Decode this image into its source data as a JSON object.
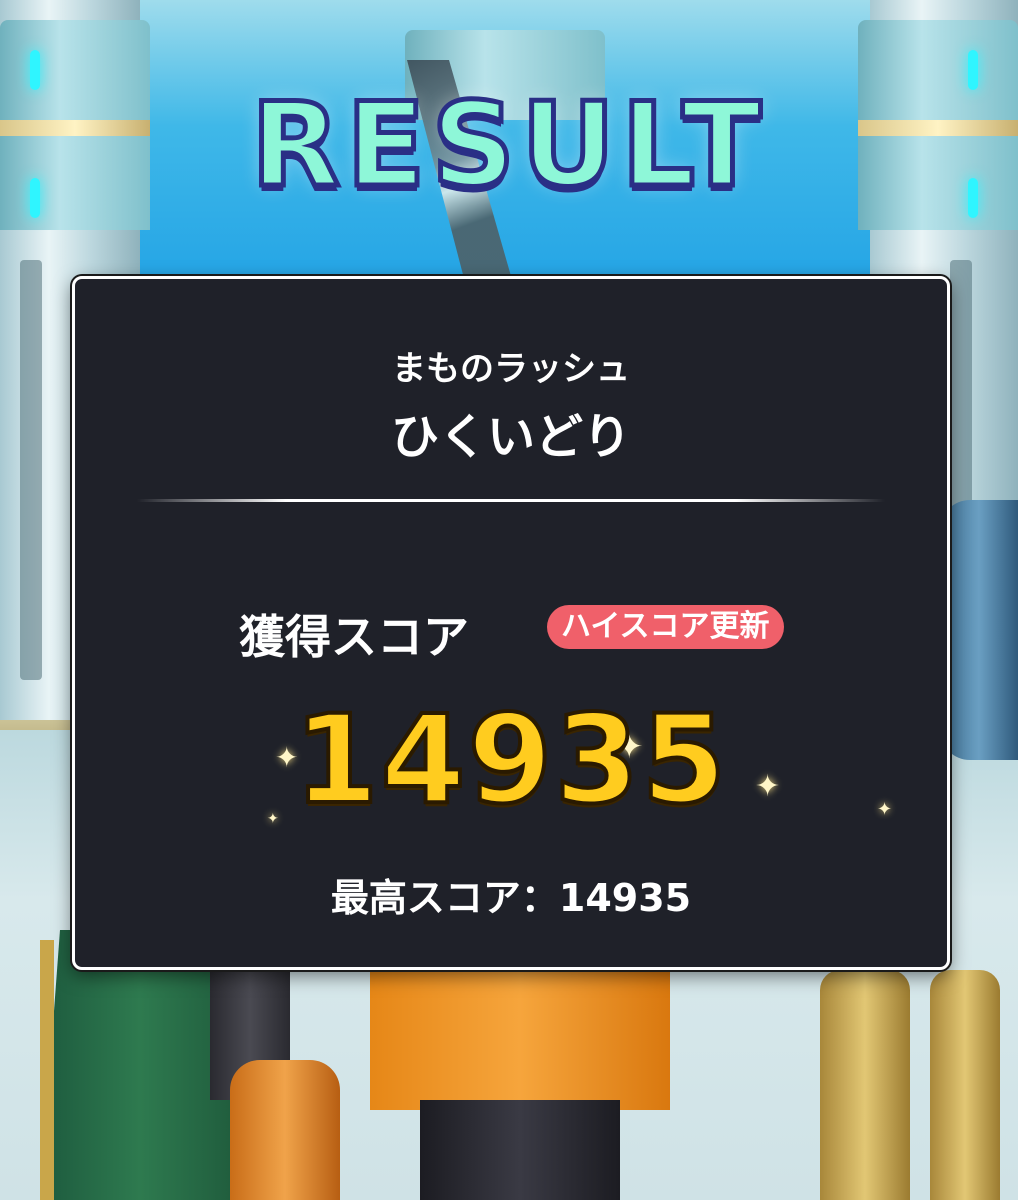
{
  "header": {
    "title": "RESULT"
  },
  "panel": {
    "mode": "まものラッシュ",
    "stage": "ひくいどり",
    "score_label": "獲得スコア",
    "badge": "ハイスコア更新",
    "score": "14935",
    "best_score_line": "最高スコア：14935"
  },
  "icons": {
    "sparkle": "✦"
  },
  "colors": {
    "title_fill": "#8ef7d8",
    "title_outline": "#2a2f86",
    "panel_bg": "#1f2129",
    "score": "#ffcc1f",
    "badge": "#f0606a"
  }
}
